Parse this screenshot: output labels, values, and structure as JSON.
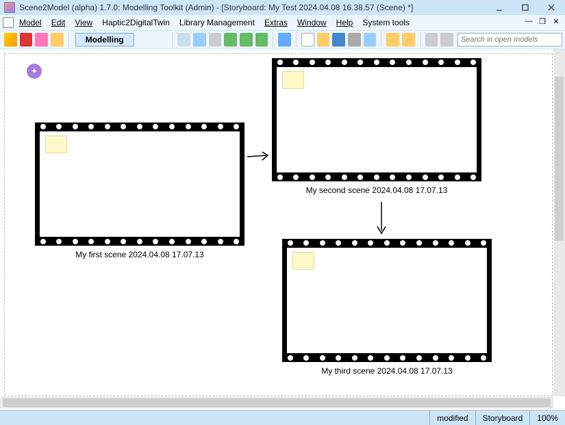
{
  "titlebar": {
    "text": "Scene2Model (alpha) 1.7.0: Modelling Toolkit (Admin) - [Storyboard: My Test 2024.04.08 16.38.57 (Scene) *]"
  },
  "menus": {
    "model": "Model",
    "edit": "Edit",
    "view": "View",
    "haptic": "Haptic2DigitalTwin",
    "library": "Library Management",
    "extras": "Extras",
    "window": "Window",
    "help": "Help",
    "systools": "System tools"
  },
  "toolbar": {
    "mode": "Modelling",
    "search_placeholder": "Search in open models"
  },
  "scenes": {
    "first": {
      "caption": "My first scene 2024.04.08 17.07.13"
    },
    "second": {
      "caption": "My second scene 2024.04.08 17.07.13"
    },
    "third": {
      "caption": "My third scene 2024.04.08 17.07.13"
    }
  },
  "status": {
    "modified": "modified",
    "type": "Storyboard",
    "zoom": "100%"
  }
}
